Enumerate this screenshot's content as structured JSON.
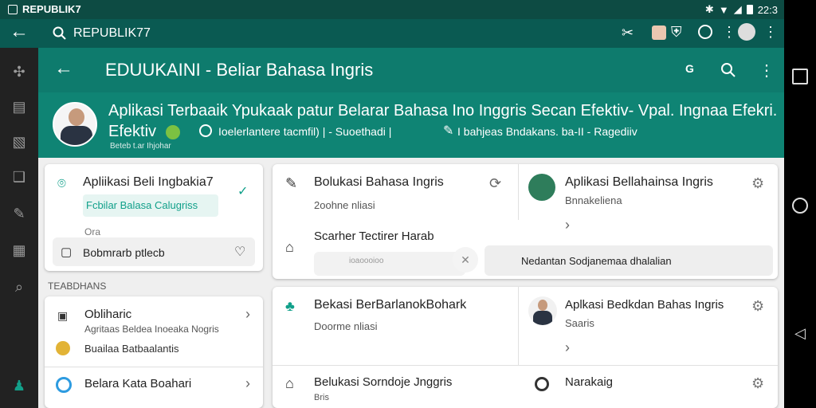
{
  "status": {
    "carrier": "REPUBLIK7",
    "time": "22:3"
  },
  "search": {
    "query": "REPUBLIK77"
  },
  "appbar": {
    "title": "EDUUKAINI - Beliar Bahasa Ingris"
  },
  "banner": {
    "line1": "Aplikasi Terbaaik  Ypukaak patur Belarar Bahasa Ino Inggris  Secan Efektiv- Vpal. Ingnaa Efekri.",
    "line2_prefix": "Efektiv",
    "meta": "Ioelerlantere tacmfil) | - Suoethadi |",
    "meta2": "I bahjeas Bndakans. ba-II - Ragediiv",
    "tag": "Beteb t.ar Ihjohar"
  },
  "left_cards": {
    "top": {
      "title": "Apliikasi Beli Ingbakia7",
      "link": "Fcbilar Balasa Calugriss",
      "small": "Ora",
      "action": "Bobmrarb ptlecb"
    },
    "section_label": "TEABDHANS",
    "items": [
      {
        "title": "Obliharic",
        "sub": "Agritaas Beldea Inoeaka Nogris",
        "sub2": "Buailaa Batbaalantis"
      },
      {
        "title": "Belara Kata Boahari",
        "sub": ""
      }
    ]
  },
  "grid": [
    {
      "title": "Bolukasi Bahasa Ingris",
      "sub": "2oohne nliasi"
    },
    {
      "title": "Aplikasi Bellahainsa Ingris",
      "sub": "Bnnakeliena"
    },
    {
      "title": "Bekasi BerBarlanokBohark",
      "sub": "Doorme nliasi"
    },
    {
      "title": "Aplkasi Bedkdan Bahas Ingris",
      "sub": "Saaris"
    },
    {
      "title": "Belukasi Sorndoje Jnggris",
      "sub": "Bris"
    },
    {
      "title": "Narakaig",
      "sub": ""
    }
  ],
  "mid": {
    "label": "Scarher Tectirer Harab",
    "right_text": "Nedantan Sodjanemaa dhalalian",
    "input_hint": "ioaoooioo"
  },
  "colors": {
    "teal_dark": "#0a5a52",
    "teal": "#0f8474",
    "accent": "#11a08a"
  }
}
